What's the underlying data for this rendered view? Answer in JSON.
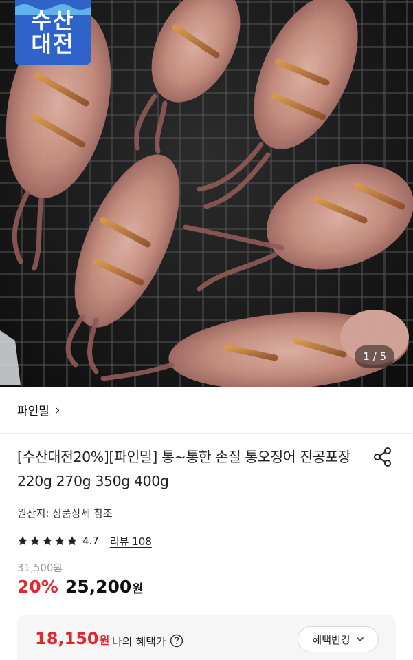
{
  "hero": {
    "badge_line1": "수산",
    "badge_line2": "대전",
    "image_counter": "1 / 5",
    "image_alt": "grilled-squid-on-grill-photo"
  },
  "seller": {
    "name": "파인밀",
    "chevron": "›"
  },
  "product": {
    "title": "[수산대전20%][파인밀] 통~통한 손질 통오징어 진공포장 220g 270g 350g 400g",
    "origin": "원산지: 상품상세 참조",
    "rating": "4.7",
    "rating_stars": 5,
    "review_link": "리뷰 108",
    "original_price": "31,500",
    "original_price_unit": "원",
    "discount": "20%",
    "sale_price": "25,200",
    "sale_price_unit": "원"
  },
  "benefit": {
    "price": "18,150",
    "price_unit": "원",
    "label": "나의 혜택가",
    "change_button": "혜택변경"
  },
  "icons": {
    "share": "share-icon",
    "help": "question-circle-icon",
    "chevron_down": "chevron-down-icon",
    "star": "star-icon"
  },
  "colors": {
    "badge_blue": "#2f63c9",
    "discount_red": "#e3282b",
    "benefit_bg": "#f6f6f7"
  }
}
